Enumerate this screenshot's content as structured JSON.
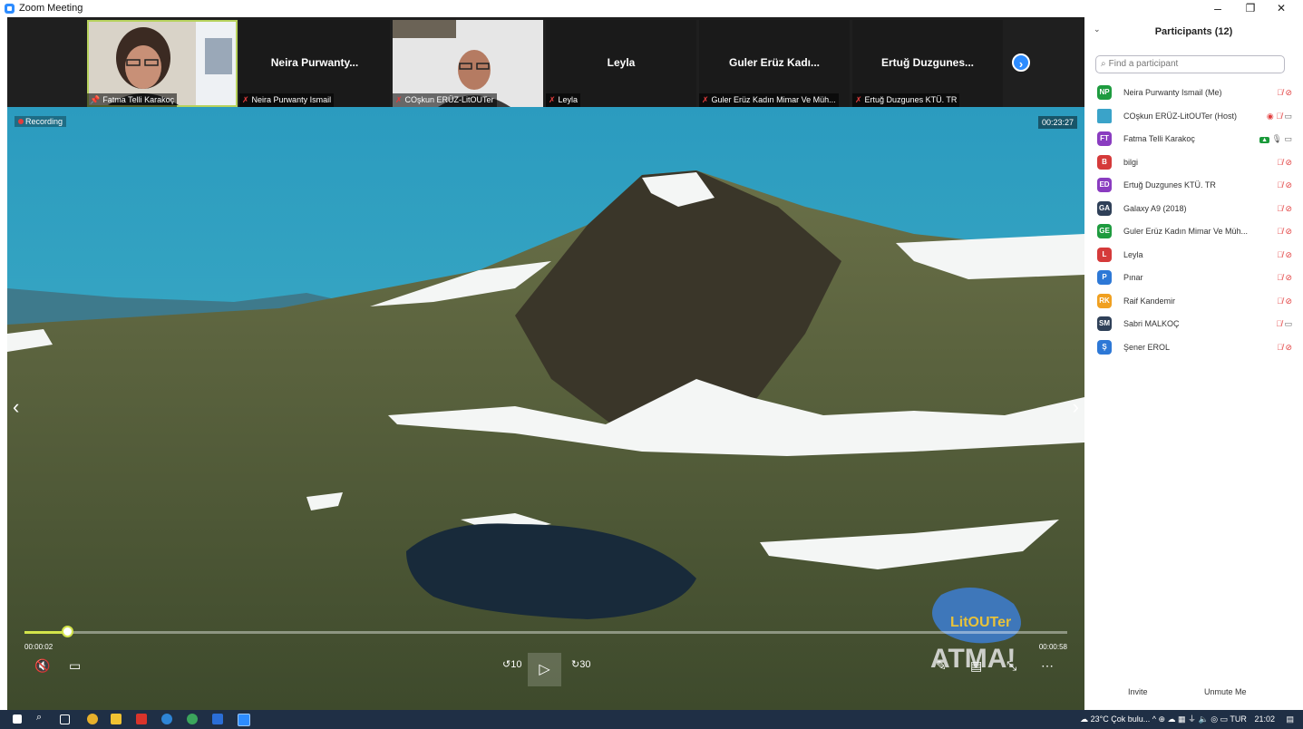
{
  "window": {
    "title": "Zoom Meeting",
    "minimize": "–",
    "restore": "❐",
    "close": "✕"
  },
  "strip": {
    "tiles": [
      {
        "name": "",
        "caption": "Fatma Telli Karakoç",
        "pinned": true
      },
      {
        "name": "Neira Purwanty...",
        "caption": "Neira Purwanty Ismail"
      },
      {
        "name": "",
        "caption": "COşkun ERÜZ-LitOUTer"
      },
      {
        "name": "Leyla",
        "caption": "Leyla"
      },
      {
        "name": "Guler Erüz Kadı...",
        "caption": "Guler Erüz Kadın Mimar Ve Müh..."
      },
      {
        "name": "Ertuğ Duzgunes...",
        "caption": "Ertuğ Duzgunes KTÜ. TR"
      }
    ],
    "next_icon": "›"
  },
  "video": {
    "recording_label": "Recording",
    "clock": "00:23:27",
    "current_time": "00:00:02",
    "end_time": "00:00:58",
    "progress": 0.04,
    "rewind_label": "10",
    "forward_label": "30",
    "logo_text": "LitOUTer",
    "logo_sub": "ATMA!"
  },
  "panel": {
    "title": "Participants (12)",
    "search_placeholder": "Find a participant",
    "participants": [
      {
        "initials": "NP",
        "name": "Neira Purwanty Ismail (Me)",
        "color": "#1e9b3f",
        "icons": "mic-muted video-off"
      },
      {
        "initials": "",
        "name": "COşkun ERÜZ-LitOUTer (Host)",
        "color": "#3aa3c9",
        "icons": "record mic-muted video-on"
      },
      {
        "initials": "FT",
        "name": "Fatma Telli Karakoç",
        "color": "#8a3cc0",
        "icons": "share mic-on video-on"
      },
      {
        "initials": "B",
        "name": "bilgi",
        "color": "#d53a3a",
        "icons": "mic-muted video-off"
      },
      {
        "initials": "ED",
        "name": "Ertuğ Duzgunes KTÜ. TR",
        "color": "#8a3cc0",
        "icons": "mic-muted video-off"
      },
      {
        "initials": "GA",
        "name": "Galaxy A9 (2018)",
        "color": "#2f4058",
        "icons": "mic-muted video-off"
      },
      {
        "initials": "GE",
        "name": "Guler Erüz Kadın Mimar Ve Müh...",
        "color": "#1e9b3f",
        "icons": "mic-muted video-off"
      },
      {
        "initials": "L",
        "name": "Leyla",
        "color": "#d53a3a",
        "icons": "mic-muted video-off"
      },
      {
        "initials": "P",
        "name": "Pınar",
        "color": "#2d78d6",
        "icons": "mic-muted video-off"
      },
      {
        "initials": "RK",
        "name": "Raif Kandemir",
        "color": "#f0a020",
        "icons": "mic-muted video-off"
      },
      {
        "initials": "SM",
        "name": "Sabri MALKOÇ",
        "color": "#2f4058",
        "icons": "mic-muted video-on"
      },
      {
        "initials": "Ş",
        "name": "Şener EROL",
        "color": "#2d78d6",
        "icons": "mic-muted video-off"
      }
    ],
    "invite_label": "Invite",
    "unmute_label": "Unmute Me"
  },
  "taskbar": {
    "weather": "23°C  Çok bulu...",
    "lang": "TUR",
    "time": "21:02"
  }
}
